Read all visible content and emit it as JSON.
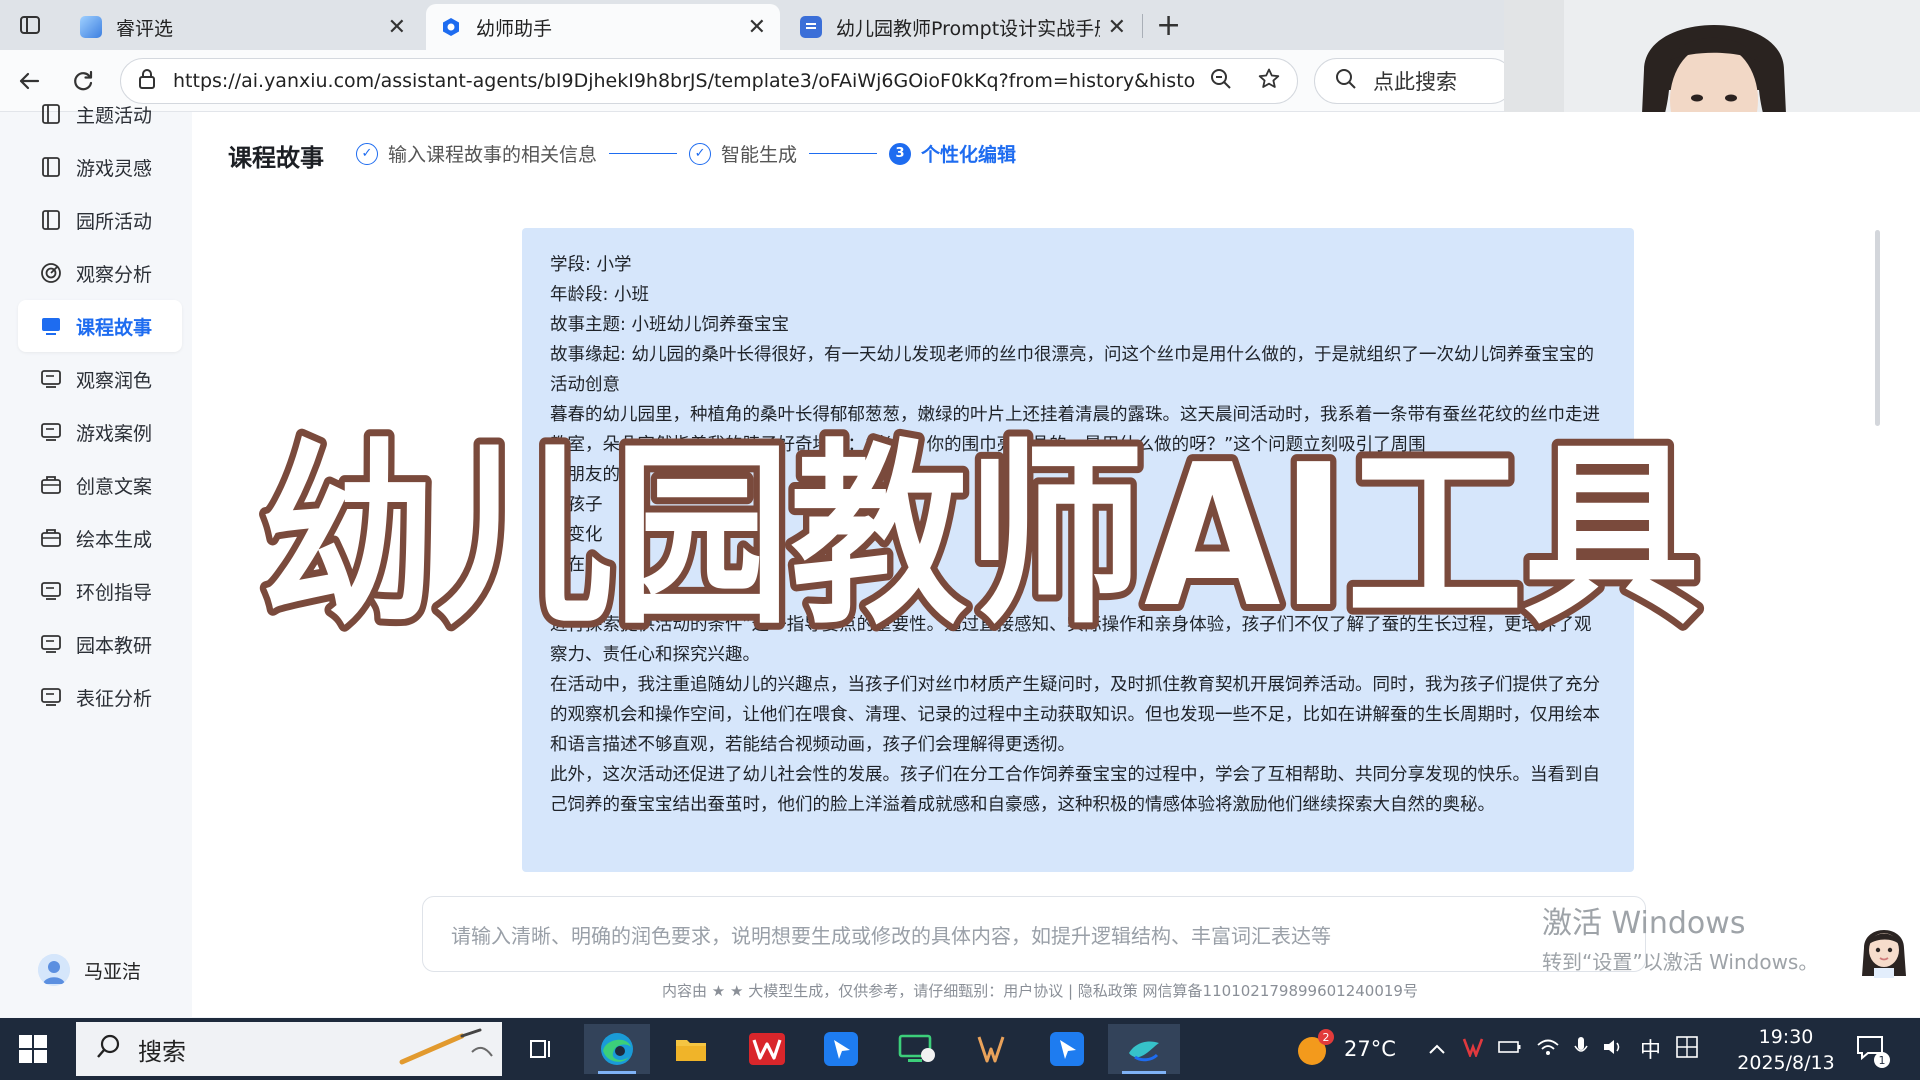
{
  "browser": {
    "tabs": [
      {
        "label": "睿评选",
        "active": false
      },
      {
        "label": "幼师助手",
        "active": true
      },
      {
        "label": "幼儿园教师Prompt设计实战手册",
        "active": false
      }
    ],
    "url": "https://ai.yanxiu.com/assistant-agents/bI9DjhekI9h8brJS/template3/oFAiWj6GOioF0kKq?from=history&histor...",
    "search_placeholder": "点此搜索"
  },
  "sidebar": {
    "items": [
      {
        "label": "主题活动",
        "icon": "book-icon"
      },
      {
        "label": "游戏灵感",
        "icon": "book-icon"
      },
      {
        "label": "园所活动",
        "icon": "book-icon"
      },
      {
        "label": "观察分析",
        "icon": "target-icon"
      },
      {
        "label": "课程故事",
        "icon": "monitor-icon",
        "active": true
      },
      {
        "label": "观察润色",
        "icon": "monitor-icon"
      },
      {
        "label": "游戏案例",
        "icon": "monitor-icon"
      },
      {
        "label": "创意文案",
        "icon": "briefcase-icon"
      },
      {
        "label": "绘本生成",
        "icon": "briefcase-icon"
      },
      {
        "label": "环创指导",
        "icon": "monitor-icon"
      },
      {
        "label": "园本教研",
        "icon": "monitor-icon"
      },
      {
        "label": "表征分析",
        "icon": "monitor-icon"
      }
    ],
    "user_name": "马亚洁"
  },
  "main": {
    "title": "课程故事",
    "steps": [
      {
        "label": "输入课程故事的相关信息",
        "state": "done"
      },
      {
        "label": "智能生成",
        "state": "done"
      },
      {
        "label": "个性化编辑",
        "state": "current",
        "number": "3"
      }
    ],
    "content": [
      "学段: 小学",
      "年龄段: 小班",
      "故事主题: 小班幼儿饲养蚕宝宝",
      "故事缘起: 幼儿园的桑叶长得很好，有一天幼儿发现老师的丝巾很漂亮，问这个丝巾是用什么做的，于是就组织了一次幼儿饲养蚕宝宝的活动创意",
      "暮春的幼儿园里，种植角的桑叶长得郁郁葱葱，嫩绿的叶片上还挂着清晨的露珠。这天晨间活动时，我系着一条带有蚕丝花纹的丝巾走进教室，朵朵突然指着我的脖子好奇地问：“老师，你的围巾亮晶晶的，是用什么做的呀？”这个问题立刻吸引了周围",
      "小朋友的",
      "着孩子",
      "、变化",
      "们在亲",
      "进行探索提供活动的条件”这一指导要点的重要性。通过直接感知、实际操作和亲身体验，孩子们不仅了解了蚕的生长过程，更培养了观察力、责任心和探究兴趣。",
      "在活动中，我注重追随幼儿的兴趣点，当孩子们对丝巾材质产生疑问时，及时抓住教育契机开展饲养活动。同时，我为孩子们提供了充分的观察机会和操作空间，让他们在喂食、清理、记录的过程中主动获取知识。但也发现一些不足，比如在讲解蚕的生长周期时，仅用绘本和语言描述不够直观，若能结合视频动画，孩子们会理解得更透彻。",
      "此外，这次活动还促进了幼儿社会性的发展。孩子们在分工合作饲养蚕宝宝的过程中，学会了互相帮助、共同分享发现的快乐。当看到自己饲养的蚕宝宝结出蚕茧时，他们的脸上洋溢着成就感和自豪感，这种积极的情感体验将激励他们继续探索大自然的奥秘。"
    ],
    "input_placeholder": "请输入清晰、明确的润色要求，说明想要生成或修改的具体内容，如提升逻辑结构、丰富词汇表达等",
    "footer": "内容由 ★ ★ 大模型生成，仅供参考，请仔细甄别：用户协议 | 隐私政策 网信算备110102179899601240019号"
  },
  "watermark": {
    "line1": "激活 Windows",
    "line2": "转到“设置”以激活 Windows。"
  },
  "overlay_title": "幼儿园教师AI工具",
  "taskbar": {
    "search_label": "搜索",
    "weather": "27°C",
    "weather_badge": "2",
    "ime": "中",
    "time": "19:30",
    "date": "2025/8/13",
    "notification_count": "1"
  },
  "colors": {
    "accent": "#1e6cf0",
    "content_bg": "#d6e6fb",
    "overlay_fill": "#ffffff",
    "overlay_stroke": "#7a4a3c",
    "taskbar": "#1e2a3c"
  }
}
